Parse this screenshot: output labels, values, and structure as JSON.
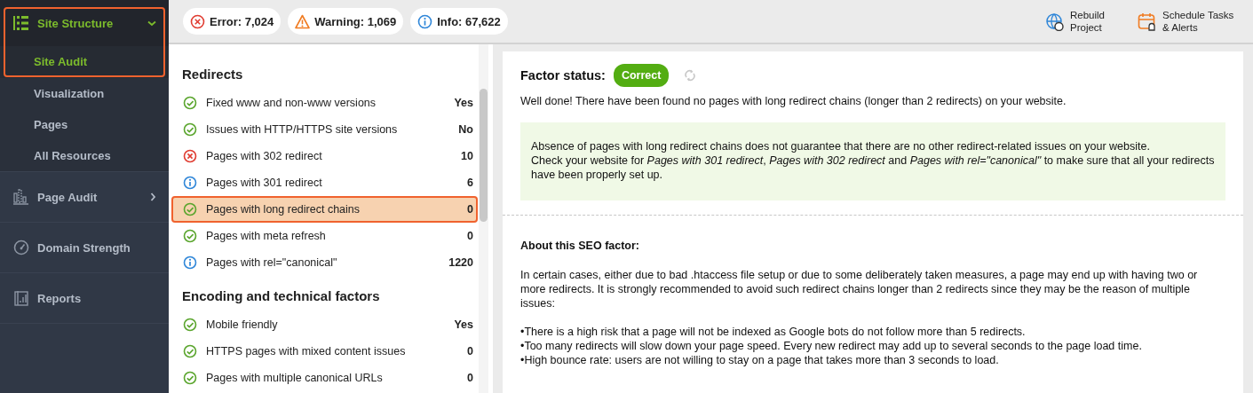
{
  "sidebar": {
    "groups": [
      {
        "kind": "structure",
        "label": "Site Structure",
        "expanded": true,
        "selected": true,
        "children": [
          {
            "label": "Site Audit",
            "selected": true
          },
          {
            "label": "Visualization",
            "selected": false
          },
          {
            "label": "Pages",
            "selected": false
          },
          {
            "label": "All Resources",
            "selected": false
          }
        ]
      },
      {
        "kind": "audit",
        "label": "Page Audit",
        "expanded": false,
        "selected": false
      },
      {
        "kind": "strength",
        "label": "Domain Strength",
        "selected": false
      },
      {
        "kind": "reports",
        "label": "Reports",
        "selected": false
      }
    ]
  },
  "toolbar": {
    "counters": [
      {
        "kind": "error",
        "text": "Error: 7,024"
      },
      {
        "kind": "warning",
        "text": "Warning: 1,069"
      },
      {
        "kind": "info",
        "text": "Info: 67,622"
      }
    ],
    "actions": [
      {
        "kind": "rebuild",
        "label": "Rebuild Project"
      },
      {
        "kind": "schedule",
        "label": "Schedule Tasks & Alerts"
      }
    ]
  },
  "factors": {
    "sections": [
      {
        "title": "Redirects",
        "items": [
          {
            "kind": "ok",
            "label": "Fixed www and non-www versions",
            "value": "Yes",
            "selected": false
          },
          {
            "kind": "ok",
            "label": "Issues with HTTP/HTTPS site versions",
            "value": "No",
            "selected": false
          },
          {
            "kind": "error",
            "label": "Pages with 302 redirect",
            "value": "10",
            "selected": false
          },
          {
            "kind": "info",
            "label": "Pages with 301 redirect",
            "value": "6",
            "selected": false
          },
          {
            "kind": "ok",
            "label": "Pages with long redirect chains",
            "value": "0",
            "selected": true
          },
          {
            "kind": "ok",
            "label": "Pages with meta refresh",
            "value": "0",
            "selected": false
          },
          {
            "kind": "info",
            "label": "Pages with rel=\"canonical\"",
            "value": "1220",
            "selected": false
          }
        ]
      },
      {
        "title": "Encoding and technical factors",
        "items": [
          {
            "kind": "ok",
            "label": "Mobile friendly",
            "value": "Yes",
            "selected": false
          },
          {
            "kind": "ok",
            "label": "HTTPS pages with mixed content issues",
            "value": "0",
            "selected": false
          },
          {
            "kind": "ok",
            "label": "Pages with multiple canonical URLs",
            "value": "0",
            "selected": false
          }
        ]
      }
    ]
  },
  "detail": {
    "status_label": "Factor status:",
    "status": {
      "kind": "correct",
      "text": "Correct"
    },
    "summary": "Well done! There have been found no pages with long redirect chains (longer than 2 redirects) on your website.",
    "note": [
      "Absence of pages with long redirect chains does not guarantee that there are no other redirect-related issues on your website.",
      "Check your website for *Pages with 301 redirect*, *Pages with 302 redirect* and *Pages with rel=\"canonical\"*  to make sure that all your redirects have been properly set up."
    ],
    "about_title": "About this SEO factor:",
    "about_text": "In certain cases, either due to bad .htaccess file setup or due to some deliberately taken measures, a page may end up with having two or more redirects. It is strongly recommended to avoid such redirect chains longer than 2 redirects since they may be the reason of multiple issues:",
    "bullets": [
      "•There is a high risk that a page will not be indexed as Google bots do not follow more than 5 redirects.",
      "•Too many redirects will slow down your page speed. Every new redirect may add up to several seconds to the page load time.",
      "•High bounce rate: users are not willing to stay on a page that takes more than 3 seconds to load."
    ]
  }
}
